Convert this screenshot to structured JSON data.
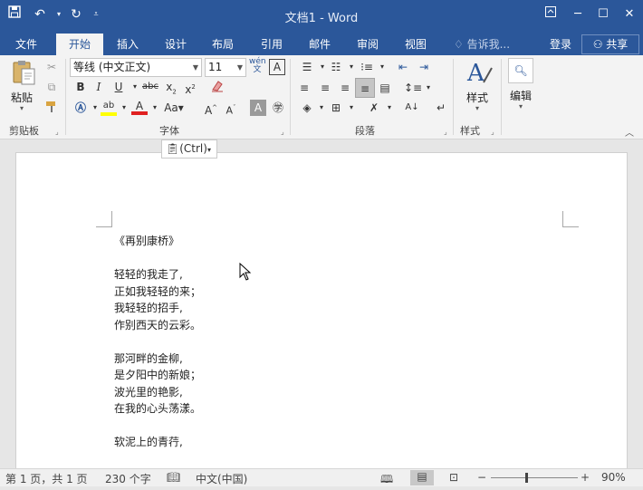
{
  "window": {
    "title": "文档1 - Word"
  },
  "tabs": [
    "文件",
    "开始",
    "插入",
    "设计",
    "布局",
    "引用",
    "邮件",
    "审阅",
    "视图"
  ],
  "tell_me": "告诉我...",
  "account": {
    "signin": "登录",
    "share": "共享"
  },
  "ribbon": {
    "paste_label": "粘贴",
    "font_name": "等线 (中文正文)",
    "font_size": "11",
    "style_label": "样式",
    "edit_label": "编辑",
    "groups": {
      "clipboard": "剪贴板",
      "font": "字体",
      "paragraph": "段落",
      "styles": "样式"
    }
  },
  "paste_options": "(Ctrl)",
  "document": {
    "lines": [
      "《再别康桥》",
      "",
      "轻轻的我走了,",
      "正如我轻轻的来；",
      "我轻轻的招手,",
      "作别西天的云彩。",
      "",
      "那河畔的金柳,",
      "是夕阳中的新娘；",
      "波光里的艳影,",
      "在我的心头荡漾。",
      "",
      "软泥上的青荇,"
    ]
  },
  "status": {
    "page": "第 1 页，共 1 页",
    "words": "230 个字",
    "language": "中文(中国)",
    "zoom": "90%"
  },
  "colors": {
    "accent": "#2b579a",
    "highlight": "#ffff00",
    "font_color": "#e02020"
  }
}
